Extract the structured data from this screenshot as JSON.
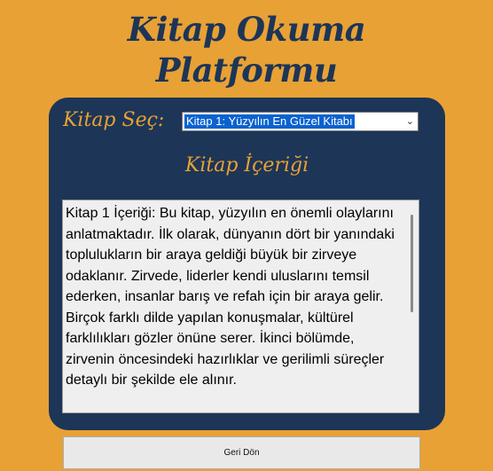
{
  "app": {
    "title_line1": "Kitap Okuma",
    "title_line2": "Platformu"
  },
  "selector": {
    "label": "Kitap Seç:",
    "selected": "Kitap 1: Yüzyılın En Güzel Kitabı",
    "arrow_icon": "chevron-down-icon"
  },
  "content": {
    "heading": "Kitap İçeriği",
    "text": "Kitap 1 İçeriği: Bu kitap, yüzyılın en önemli olaylarını anlatmaktadır. İlk olarak, dünyanın dört bir yanındaki toplulukların bir araya geldiği büyük bir zirveye odaklanır. Zirvede, liderler kendi uluslarını temsil ederken, insanlar barış ve refah için bir araya gelir. Birçok farklı dilde yapılan konuşmalar, kültürel farklılıkları gözler önüne serer. İkinci bölümde, zirvenin öncesindeki hazırlıklar ve gerilimli süreçler detaylı bir şekilde ele alınır."
  },
  "actions": {
    "back_label": "Geri Dön"
  },
  "colors": {
    "background": "#e8a135",
    "panel": "#1d3557",
    "accent": "#e8a135",
    "selection": "#0a62d0"
  }
}
